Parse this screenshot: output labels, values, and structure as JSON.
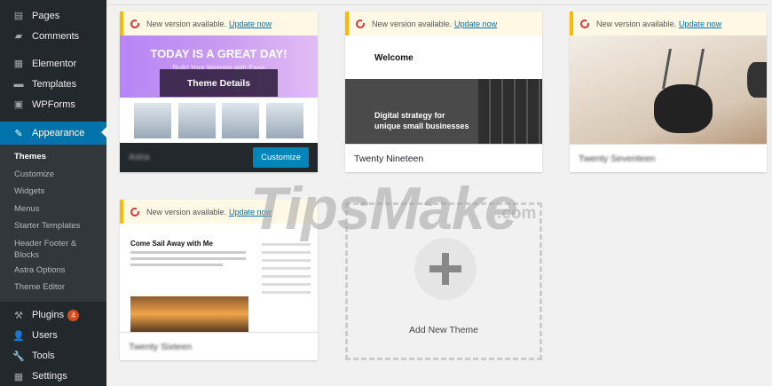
{
  "sidebar": {
    "items_top": [
      {
        "label": "Pages",
        "icon": "pages-icon"
      },
      {
        "label": "Comments",
        "icon": "comments-icon"
      },
      {
        "label": "Elementor",
        "icon": "elementor-icon"
      },
      {
        "label": "Templates",
        "icon": "templates-icon"
      },
      {
        "label": "WPForms",
        "icon": "wpforms-icon"
      }
    ],
    "appearance": {
      "label": "Appearance",
      "icon": "appearance-icon"
    },
    "submenu": [
      "Themes",
      "Customize",
      "Widgets",
      "Menus",
      "Starter Templates",
      "Header Footer &",
      "Blocks",
      "Astra Options",
      "Theme Editor"
    ],
    "items_bottom": [
      {
        "label": "Plugins",
        "icon": "plugins-icon",
        "badge": "4"
      },
      {
        "label": "Users",
        "icon": "users-icon"
      },
      {
        "label": "Tools",
        "icon": "tools-icon"
      },
      {
        "label": "Settings",
        "icon": "settings-icon"
      }
    ]
  },
  "update_notice": {
    "text": "New version available.",
    "link": "Update now"
  },
  "themes": {
    "astra": {
      "hero_title": "TODAY IS A GREAT DAY!",
      "hero_sub": "Build Your Website with Ease",
      "overlay": "Theme Details",
      "name": "Astra",
      "customize": "Customize"
    },
    "twenty_nineteen": {
      "welcome": "Welcome",
      "tagline_1": "Digital strategy for",
      "tagline_2": "unique small businesses",
      "name": "Twenty Nineteen"
    },
    "twenty_seventeen": {
      "name": "Twenty Seventeen"
    },
    "twenty_sixteen": {
      "post_title": "Come Sail Away with Me",
      "name": "Twenty Sixteen"
    }
  },
  "add_new": {
    "label": "Add New Theme"
  },
  "watermark": {
    "text": "TipsMake",
    "suffix": ".com"
  }
}
